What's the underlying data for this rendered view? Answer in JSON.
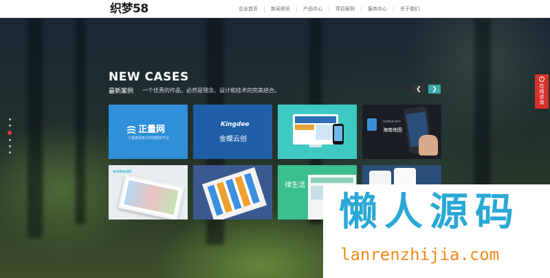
{
  "header": {
    "logo": "织梦58",
    "nav": [
      "企业首页",
      "新闻资讯",
      "产品中心",
      "项目案例",
      "服务中心",
      "关于我们"
    ]
  },
  "section": {
    "title_en": "NEW CASES",
    "title_cn": "最新案例",
    "description": "一个优秀的作品，必然是理念、设计和技术的完美结合。"
  },
  "cases": [
    {
      "brand": "正量网",
      "tagline": "工程建设电子商务服务平台"
    },
    {
      "brand_en": "Kingdee",
      "brand": "金蝶云创"
    },
    {
      "brand": "",
      "tagline": ""
    },
    {
      "brand": "海南地图",
      "tagline": "HAINAN MAP"
    },
    {
      "brand": "wokeshi",
      "tagline": ""
    },
    {
      "brand": "",
      "tagline": ""
    },
    {
      "brand": "律生活",
      "tagline": ""
    },
    {
      "brand": "",
      "tagline": ""
    }
  ],
  "pager": {
    "dots": 6,
    "active_index": 2
  },
  "consult": {
    "label": "在线咨询"
  },
  "watermark": {
    "cn": "懒人源码",
    "en": "lanrenzhijia.com"
  },
  "colors": {
    "accent": "#3aa8a6",
    "active_dot": "#e23b3b",
    "consult": "#d4322c",
    "watermark_cn": "#2aa8d6",
    "watermark_en": "#f48a1b"
  }
}
